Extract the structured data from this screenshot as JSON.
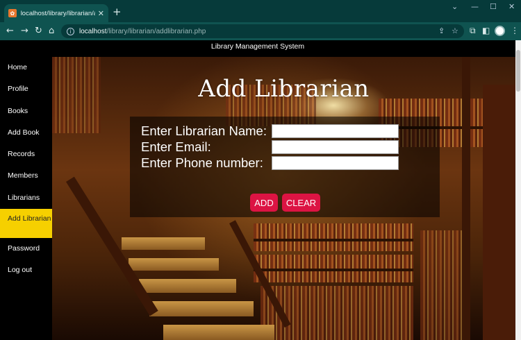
{
  "browser": {
    "tab_title": "localhost/library/librarian/addlib",
    "tab_close": "✕",
    "new_tab": "+",
    "url_host": "localhost",
    "url_path": "/library/librarian/addlibrarian.php",
    "nav": {
      "back": "←",
      "forward": "→",
      "reload": "↻",
      "home": "⌂"
    },
    "window_controls": {
      "chevron": "⌄",
      "minimize": "—",
      "maximize": "☐",
      "close": "✕"
    },
    "toolbar_icons": {
      "share": "⇪",
      "bookmark": "☆",
      "extensions": "⧉",
      "sidebar": "◧",
      "menu": "⋮"
    }
  },
  "header": {
    "title": "Library Management System"
  },
  "sidebar": {
    "items": [
      {
        "label": "Home"
      },
      {
        "label": "Profile"
      },
      {
        "label": "Books"
      },
      {
        "label": "Add Book"
      },
      {
        "label": "Records"
      },
      {
        "label": "Members"
      },
      {
        "label": "Librarians"
      },
      {
        "label": "Add Librarian",
        "active": true
      },
      {
        "label": "Password"
      },
      {
        "label": "Log out"
      }
    ]
  },
  "main": {
    "title": "Add Librarian",
    "form": {
      "name_label": "Enter Librarian Name:",
      "name_value": "",
      "email_label": "Enter Email:",
      "email_value": "",
      "phone_label": "Enter Phone number:",
      "phone_value": "",
      "add_label": "ADD",
      "clear_label": "CLEAR"
    }
  },
  "colors": {
    "accent_active": "#f6d000",
    "button": "#dc1443",
    "chrome_dark": "#063a3a",
    "chrome_toolbar": "#0f5350"
  }
}
